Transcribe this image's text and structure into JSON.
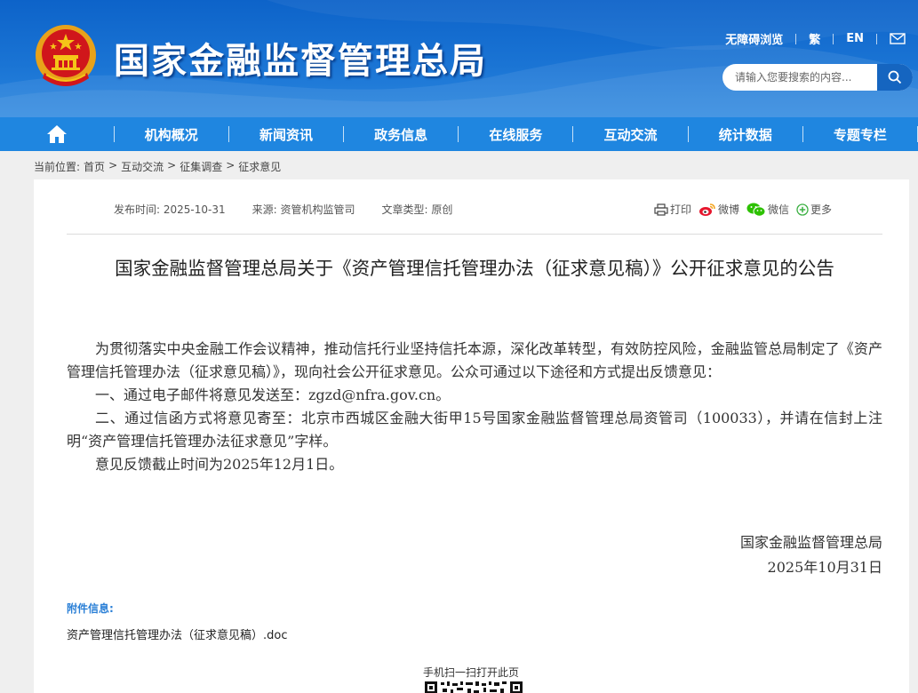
{
  "header": {
    "site_title": "国家金融监督管理总局",
    "toplinks": [
      "无障碍浏览",
      "繁",
      "EN"
    ],
    "search_placeholder": "请输入您要搜索的内容..."
  },
  "nav": {
    "items": [
      "机构概况",
      "新闻资讯",
      "政务信息",
      "在线服务",
      "互动交流",
      "统计数据",
      "专题专栏"
    ]
  },
  "breadcrumb": {
    "label": "当前位置:",
    "items": [
      "首页",
      "互动交流",
      "征集调查",
      "征求意见"
    ],
    "separator": ">"
  },
  "meta": {
    "publish": "发布时间:  2025-10-31",
    "source": "来源:  资管机构监管司",
    "type": "文章类型:  原创"
  },
  "share": {
    "print": "打印",
    "weibo": "微博",
    "wechat": "微信",
    "more": "更多"
  },
  "article": {
    "title": "国家金融监督管理总局关于《资产管理信托管理办法（征求意见稿）》公开征求意见的公告",
    "paragraphs": [
      "为贯彻落实中央金融工作会议精神，推动信托行业坚持信托本源，深化改革转型，有效防控风险，金融监管总局制定了《资产管理信托管理办法（征求意见稿）》，现向社会公开征求意见。公众可通过以下途径和方式提出反馈意见：",
      "一、通过电子邮件将意见发送至：zgzd@nfra.gov.cn。",
      "二、通过信函方式将意见寄至：北京市西城区金融大街甲15号国家金融监督管理总局资管司（100033），并请在信封上注明“资产管理信托管理办法征求意见”字样。",
      "意见反馈截止时间为2025年12月1日。"
    ],
    "signature_org": "国家金融监督管理总局",
    "signature_date": "2025年10月31日"
  },
  "attachment": {
    "heading": "附件信息:",
    "file": "资产管理信托管理办法（征求意见稿）.doc"
  },
  "qr": {
    "label": "手机扫一扫打开此页"
  },
  "colors": {
    "header_blue": "#1a74d4",
    "nav_blue": "#1f86e0",
    "attach_blue": "#2a7fd6"
  }
}
